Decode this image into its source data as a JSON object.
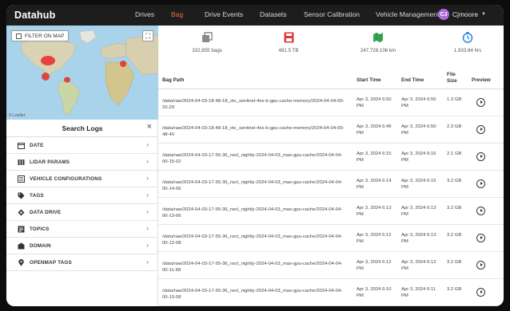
{
  "app": {
    "brand": "Datahub"
  },
  "nav": {
    "items": [
      {
        "label": "Drives"
      },
      {
        "label": "Bag"
      },
      {
        "label": "Drive Events"
      },
      {
        "label": "Datasets"
      },
      {
        "label": "Sensor Calibration"
      },
      {
        "label": "Vehicle Management"
      }
    ],
    "active": "Bag",
    "user_initials": "CJ",
    "user_name": "Cjmoore"
  },
  "map": {
    "filter_label": "FILTER ON MAP",
    "attribution": "© Leaflet"
  },
  "search": {
    "title": "Search Logs",
    "facets": [
      {
        "label": "DATE",
        "icon": "calendar-icon"
      },
      {
        "label": "LIDAR PARAMS",
        "icon": "lidar-icon"
      },
      {
        "label": "VEHICLE CONFIGURATIONS",
        "icon": "vehicle-config-icon"
      },
      {
        "label": "TAGS",
        "icon": "tag-icon"
      },
      {
        "label": "DATA DRIVE",
        "icon": "data-drive-icon"
      },
      {
        "label": "TOPICS",
        "icon": "topics-icon"
      },
      {
        "label": "DOMAIN",
        "icon": "domain-icon"
      },
      {
        "label": "OPENMAP TAGS",
        "icon": "location-pin-icon"
      }
    ]
  },
  "stats": [
    {
      "icon": "bags-icon",
      "text": "332,855 bags",
      "color": "#777777"
    },
    {
      "icon": "storage-icon",
      "text": "481.5 TB",
      "color": "#e23b3b"
    },
    {
      "icon": "map-distance-icon",
      "text": "247,728.106 km",
      "color": "#37a852"
    },
    {
      "icon": "clock-icon",
      "text": "1,933.84 hrs",
      "color": "#2f8be0"
    }
  ],
  "table": {
    "columns": {
      "path": "Bag Path",
      "start": "Start Time",
      "end": "End Time",
      "size": "File Size",
      "preview": "Preview"
    },
    "rows": [
      {
        "path": "/data/raw/2024-04-03-18-48-18_otc_sentinel-4xx-b-gpu-cache-memory/2024-04-04-00-20-29",
        "start": "Apr 3, 2024 6:50 PM",
        "end": "Apr 3, 2024 6:50 PM",
        "size": "1.3 GB"
      },
      {
        "path": "/data/raw/2024-04-03-18-48-18_otc_sentinel-4xx-b-gpu-cache-memory/2024-04-04-00-48-40",
        "start": "Apr 3, 2024 6:49 PM",
        "end": "Apr 3, 2024 6:50 PM",
        "size": "2.3 GB"
      },
      {
        "path": "/data/raw/2024-04-03-17-55-36_nscl_nightly-2024-04-03_max-gpu-cache/2024-04-04-00-15-02",
        "start": "Apr 3, 2024 6:15 PM",
        "end": "Apr 3, 2024 6:16 PM",
        "size": "2.1 GB"
      },
      {
        "path": "/data/raw/2024-04-03-17-55-36_nscl_nightly-2024-04-03_max-gpu-cache/2024-04-04-00-14-56",
        "start": "Apr 3, 2024 6:14 PM",
        "end": "Apr 3, 2024 6:15 PM",
        "size": "3.2 GB"
      },
      {
        "path": "/data/raw/2024-04-03-17-55-36_nscl_nightly-2024-04-03_max-gpu-cache/2024-04-04-00-13-06",
        "start": "Apr 3, 2024 6:13 PM",
        "end": "Apr 3, 2024 6:13 PM",
        "size": "3.2 GB"
      },
      {
        "path": "/data/raw/2024-04-03-17-55-36_nscl_nightly-2024-04-03_max-gpu-cache/2024-04-04-00-12-08",
        "start": "Apr 3, 2024 6:12 PM",
        "end": "Apr 3, 2024 6:13 PM",
        "size": "3.2 GB"
      },
      {
        "path": "/data/raw/2024-04-03-17-55-36_nscl_nightly-2024-04-03_max-gpu-cache/2024-04-04-00-11-58",
        "start": "Apr 3, 2024 6:12 PM",
        "end": "Apr 3, 2024 6:12 PM",
        "size": "3.2 GB"
      },
      {
        "path": "/data/raw/2024-04-03-17-55-36_nscl_nightly-2024-04-03_max-gpu-cache/2024-04-04-00-10-58",
        "start": "Apr 3, 2024 6:10 PM",
        "end": "Apr 3, 2024 6:11 PM",
        "size": "3.2 GB"
      }
    ]
  }
}
